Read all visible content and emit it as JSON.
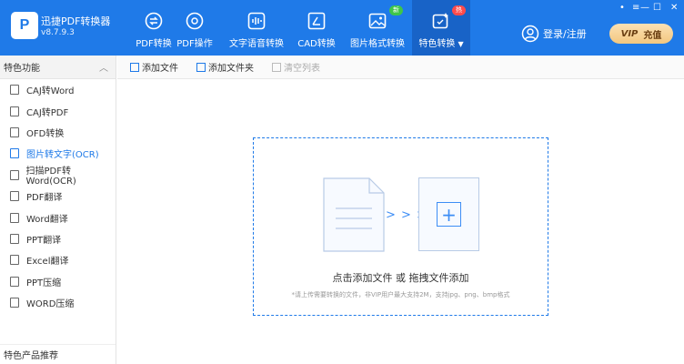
{
  "app": {
    "name": "迅捷PDF转换器",
    "version": "v8.7.9.3",
    "logo_text": "P"
  },
  "toolbar_top": {
    "items": [
      {
        "label": "PDF转换",
        "icon": "convert-icon"
      },
      {
        "label": "PDF操作",
        "icon": "settings-circle-icon"
      },
      {
        "label": "文字语音转换",
        "icon": "audio-wave-icon"
      },
      {
        "label": "CAD转换",
        "icon": "cad-icon"
      },
      {
        "label": "图片格式转换",
        "icon": "image-icon",
        "badge": "新"
      },
      {
        "label": "特色转换",
        "icon": "sparkle-icon",
        "badge": "热",
        "dropdown": "▼"
      }
    ],
    "login_label": "登录/注册",
    "vip_label": "VIP",
    "vip_action": "充值"
  },
  "window_controls": {
    "menu": "•",
    "min": "—",
    "max": "☐",
    "close": "✕"
  },
  "sidebar": {
    "header": "特色功能",
    "collapse_glyph": "︿",
    "items": [
      {
        "label": "CAJ转Word",
        "active": false
      },
      {
        "label": "CAJ转PDF",
        "active": false
      },
      {
        "label": "OFD转换",
        "active": false
      },
      {
        "label": "图片转文字(OCR)",
        "active": true
      },
      {
        "label": "扫描PDF转Word(OCR)",
        "active": false
      },
      {
        "label": "PDF翻译",
        "active": false
      },
      {
        "label": "Word翻译",
        "active": false
      },
      {
        "label": "PPT翻译",
        "active": false
      },
      {
        "label": "Excel翻译",
        "active": false
      },
      {
        "label": "PPT压缩",
        "active": false
      },
      {
        "label": "WORD压缩",
        "active": false
      }
    ],
    "footer": "特色产品推荐"
  },
  "actions": {
    "add_file": "添加文件",
    "add_folder": "添加文件夹",
    "clear_list": "清空列表"
  },
  "dropzone": {
    "arrows": "> > >",
    "plus": "+",
    "main_text": "点击添加文件 或 拖拽文件添加",
    "sub_text": "*请上传需要转换的文件，非VIP用户最大支持2M，支持jpg、png、bmp格式"
  },
  "colors": {
    "accent": "#1f7ae8",
    "active_tab": "#1863c7",
    "badge_new": "#3ec54a",
    "badge_hot": "#ff4b4b"
  }
}
